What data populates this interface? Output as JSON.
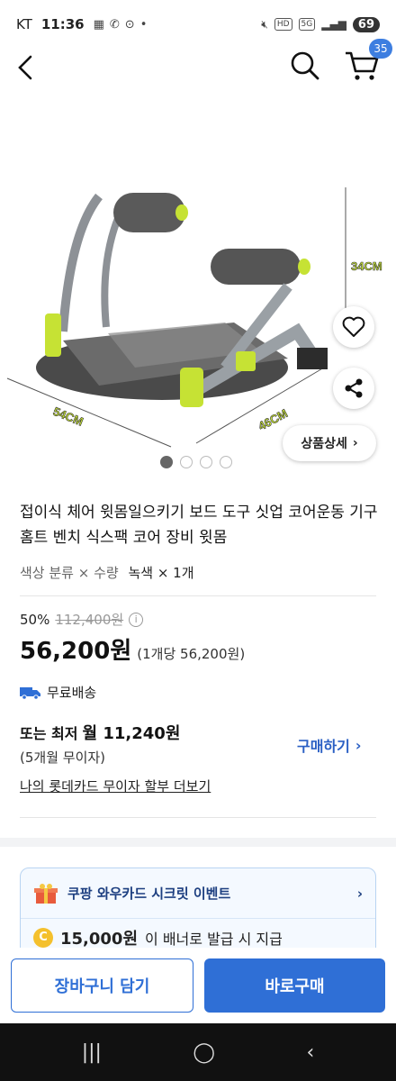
{
  "status": {
    "carrier": "KT",
    "time": "11:36",
    "battery": "69",
    "hd": "HD",
    "lte": "5G"
  },
  "cart": {
    "count": "35"
  },
  "hero": {
    "dim_height": "34CM",
    "dim_width": "54CM",
    "dim_depth": "46CM",
    "detail_label": "상품상세",
    "pages": 4,
    "active_page": 1
  },
  "product": {
    "title": "접이식 체어 윗몸일으키기 보드 도구 싯업 코어운동 기구 홈트 벤치 식스팩 코어 장비 윗몸",
    "option_label": "색상 분류 × 수량",
    "option_value": "녹색 × 1개",
    "discount": "50%",
    "original_price": "112,400원",
    "price": "56,200원",
    "unit_price": "(1개당 56,200원)",
    "shipping": "무료배송",
    "installment_prefix": "또는 최저",
    "installment_amount": "월 11,240원",
    "installment_sub": "(5개월 무이자)",
    "buy_now_link": "구매하기",
    "card_link": "나의 롯데카드 무이자 할부 더보기"
  },
  "event": {
    "title": "쿠팡 와우카드 시크릿 이벤트",
    "amount": "15,000원",
    "desc": "이 배너로 발급 시 지급"
  },
  "actions": {
    "add_to_cart": "장바구니 담기",
    "buy_now": "바로구매"
  },
  "colors": {
    "accent": "#2f6fd6",
    "badge": "#3d7ee0",
    "lime": "#c6e234"
  }
}
